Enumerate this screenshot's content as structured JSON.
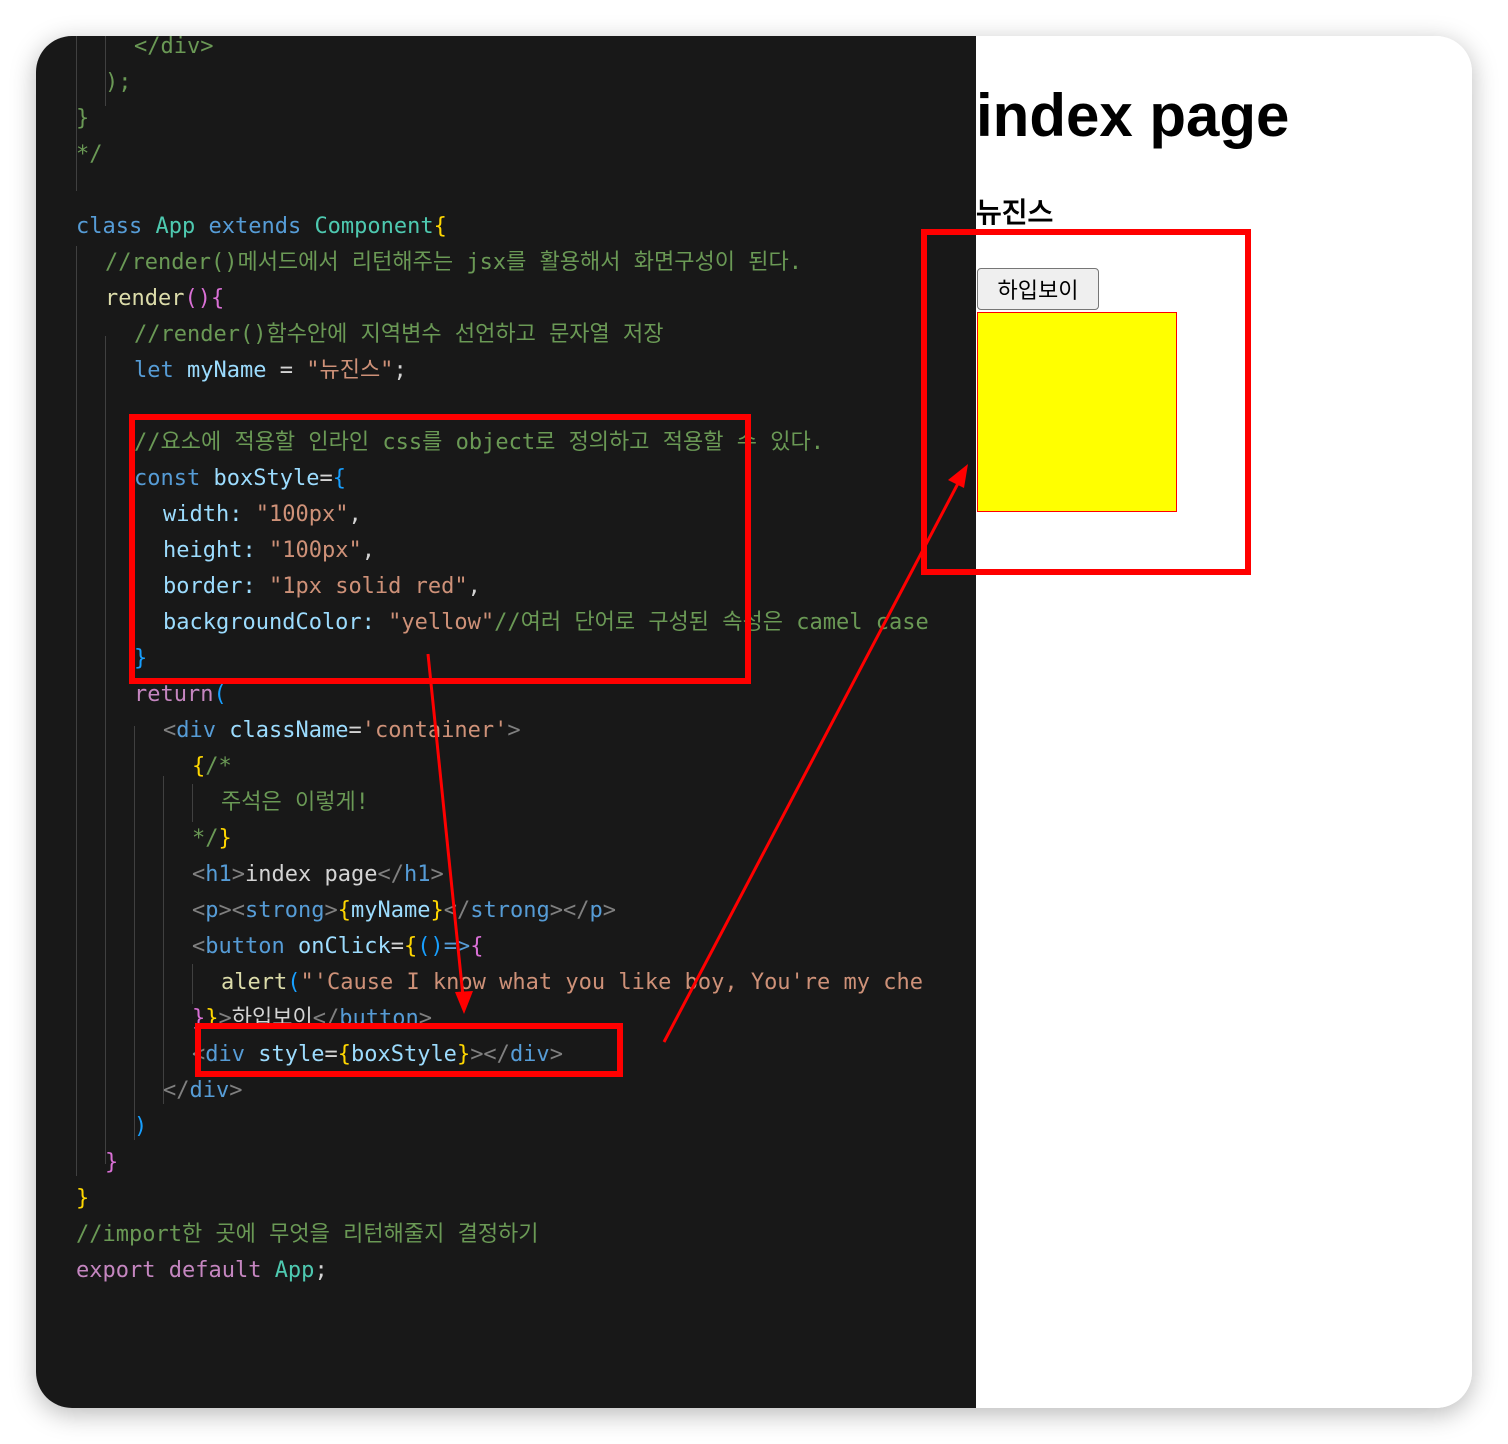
{
  "editor": {
    "lines": [
      {
        "t": "</div>",
        "c": "tok-cm",
        "x": 2
      },
      {
        "t": ");",
        "c": "tok-cm",
        "x": 1
      },
      {
        "t": "}",
        "c": "tok-cm",
        "x": 0
      },
      {
        "t": "*/",
        "c": "tok-cm",
        "x": 0
      },
      {
        "t": "",
        "c": "",
        "x": 0
      },
      {
        "segs": [
          {
            "t": "class ",
            "c": "tok-kw"
          },
          {
            "t": "App ",
            "c": "tok-cls"
          },
          {
            "t": "extends ",
            "c": "tok-kw"
          },
          {
            "t": "Component",
            "c": "tok-cls"
          },
          {
            "t": "{",
            "c": "tok-b1"
          }
        ],
        "x": 0
      },
      {
        "t": "//render()메서드에서 리턴해주는 jsx를 활용해서 화면구성이 된다.",
        "c": "tok-cm",
        "x": 1
      },
      {
        "segs": [
          {
            "t": "render",
            "c": "tok-fn"
          },
          {
            "t": "(){",
            "c": "tok-b2"
          }
        ],
        "x": 1
      },
      {
        "t": "//render()함수안에 지역변수 선언하고 문자열 저장",
        "c": "tok-cm",
        "x": 2
      },
      {
        "segs": [
          {
            "t": "let ",
            "c": "tok-kw"
          },
          {
            "t": "myName",
            "c": "tok-var"
          },
          {
            "t": " = ",
            "c": ""
          },
          {
            "t": "\"뉴진스\"",
            "c": "tok-str"
          },
          {
            "t": ";",
            "c": ""
          }
        ],
        "x": 2
      },
      {
        "t": "",
        "c": "",
        "x": 0
      },
      {
        "t": "//요소에 적용할 인라인 css를 object로 정의하고 적용할 수 있다.",
        "c": "tok-cm",
        "x": 2
      },
      {
        "segs": [
          {
            "t": "const ",
            "c": "tok-kw"
          },
          {
            "t": "boxStyle",
            "c": "tok-var"
          },
          {
            "t": "=",
            "c": ""
          },
          {
            "t": "{",
            "c": "tok-b3"
          }
        ],
        "x": 2
      },
      {
        "segs": [
          {
            "t": "width: ",
            "c": "tok-var"
          },
          {
            "t": "\"100px\"",
            "c": "tok-str"
          },
          {
            "t": ",",
            "c": ""
          }
        ],
        "x": 3
      },
      {
        "segs": [
          {
            "t": "height: ",
            "c": "tok-var"
          },
          {
            "t": "\"100px\"",
            "c": "tok-str"
          },
          {
            "t": ",",
            "c": ""
          }
        ],
        "x": 3
      },
      {
        "segs": [
          {
            "t": "border: ",
            "c": "tok-var"
          },
          {
            "t": "\"1px solid red\"",
            "c": "tok-str"
          },
          {
            "t": ",",
            "c": ""
          }
        ],
        "x": 3
      },
      {
        "segs": [
          {
            "t": "backgroundColor: ",
            "c": "tok-var"
          },
          {
            "t": "\"yellow\"",
            "c": "tok-str"
          },
          {
            "t": "//여러 단어로 구성된 속성은 camel case",
            "c": "tok-cm"
          }
        ],
        "x": 3
      },
      {
        "t": "}",
        "c": "tok-b3",
        "x": 2
      },
      {
        "segs": [
          {
            "t": "return",
            "c": "tok-pink"
          },
          {
            "t": "(",
            "c": "tok-b3"
          }
        ],
        "x": 2
      },
      {
        "segs": [
          {
            "t": "<",
            "c": "tok-punc"
          },
          {
            "t": "div ",
            "c": "tok-tag"
          },
          {
            "t": "className",
            "c": "tok-var"
          },
          {
            "t": "=",
            "c": ""
          },
          {
            "t": "'container'",
            "c": "tok-str"
          },
          {
            "t": ">",
            "c": "tok-punc"
          }
        ],
        "x": 3
      },
      {
        "segs": [
          {
            "t": "{",
            "c": "tok-b1"
          },
          {
            "t": "/*",
            "c": "tok-cm"
          }
        ],
        "x": 4
      },
      {
        "t": "주석은 이렇게!",
        "c": "tok-cm",
        "x": 5
      },
      {
        "segs": [
          {
            "t": "*/",
            "c": "tok-cm"
          },
          {
            "t": "}",
            "c": "tok-b1"
          }
        ],
        "x": 4
      },
      {
        "segs": [
          {
            "t": "<",
            "c": "tok-punc"
          },
          {
            "t": "h1",
            "c": "tok-tag"
          },
          {
            "t": ">",
            "c": "tok-punc"
          },
          {
            "t": "index page",
            "c": ""
          },
          {
            "t": "</",
            "c": "tok-punc"
          },
          {
            "t": "h1",
            "c": "tok-tag"
          },
          {
            "t": ">",
            "c": "tok-punc"
          }
        ],
        "x": 4
      },
      {
        "segs": [
          {
            "t": "<",
            "c": "tok-punc"
          },
          {
            "t": "p",
            "c": "tok-tag"
          },
          {
            "t": "><",
            "c": "tok-punc"
          },
          {
            "t": "strong",
            "c": "tok-tag"
          },
          {
            "t": ">",
            "c": "tok-punc"
          },
          {
            "t": "{",
            "c": "tok-b1"
          },
          {
            "t": "myName",
            "c": "tok-var"
          },
          {
            "t": "}",
            "c": "tok-b1"
          },
          {
            "t": "</",
            "c": "tok-punc"
          },
          {
            "t": "strong",
            "c": "tok-tag"
          },
          {
            "t": "></",
            "c": "tok-punc"
          },
          {
            "t": "p",
            "c": "tok-tag"
          },
          {
            "t": ">",
            "c": "tok-punc"
          }
        ],
        "x": 4
      },
      {
        "segs": [
          {
            "t": "<",
            "c": "tok-punc"
          },
          {
            "t": "button ",
            "c": "tok-tag"
          },
          {
            "t": "onClick",
            "c": "tok-var"
          },
          {
            "t": "=",
            "c": ""
          },
          {
            "t": "{",
            "c": "tok-b1"
          },
          {
            "t": "()",
            "c": "tok-b3"
          },
          {
            "t": "=>",
            "c": "tok-kw"
          },
          {
            "t": "{",
            "c": "tok-b2"
          }
        ],
        "x": 4
      },
      {
        "segs": [
          {
            "t": "alert",
            "c": "tok-fn"
          },
          {
            "t": "(",
            "c": "tok-b3"
          },
          {
            "t": "\"'Cause I know what you like boy, You're my che",
            "c": "tok-str"
          }
        ],
        "x": 5
      },
      {
        "segs": [
          {
            "t": "}",
            "c": "tok-b2"
          },
          {
            "t": "}",
            "c": "tok-b1"
          },
          {
            "t": ">",
            "c": "tok-punc"
          },
          {
            "t": "하입보이",
            "c": ""
          },
          {
            "t": "</",
            "c": "tok-punc"
          },
          {
            "t": "button",
            "c": "tok-tag"
          },
          {
            "t": ">",
            "c": "tok-punc"
          }
        ],
        "x": 4
      },
      {
        "segs": [
          {
            "t": "<",
            "c": "tok-punc"
          },
          {
            "t": "div ",
            "c": "tok-tag"
          },
          {
            "t": "style",
            "c": "tok-var"
          },
          {
            "t": "=",
            "c": ""
          },
          {
            "t": "{",
            "c": "tok-b1"
          },
          {
            "t": "boxStyle",
            "c": "tok-var"
          },
          {
            "t": "}",
            "c": "tok-b1"
          },
          {
            "t": "></",
            "c": "tok-punc"
          },
          {
            "t": "div",
            "c": "tok-tag"
          },
          {
            "t": ">",
            "c": "tok-punc"
          }
        ],
        "x": 4
      },
      {
        "segs": [
          {
            "t": "</",
            "c": "tok-punc"
          },
          {
            "t": "div",
            "c": "tok-tag"
          },
          {
            "t": ">",
            "c": "tok-punc"
          }
        ],
        "x": 3
      },
      {
        "t": ")",
        "c": "tok-b3",
        "x": 2
      },
      {
        "t": "}",
        "c": "tok-b2",
        "x": 1
      },
      {
        "t": "}",
        "c": "tok-b1",
        "x": 0
      },
      {
        "t": "//import한 곳에 무엇을 리턴해줄지 결정하기",
        "c": "tok-cm",
        "x": 0
      },
      {
        "segs": [
          {
            "t": "export ",
            "c": "tok-pink"
          },
          {
            "t": "default ",
            "c": "tok-pink"
          },
          {
            "t": "App",
            "c": "tok-cls"
          },
          {
            "t": ";",
            "c": ""
          }
        ],
        "x": 0
      }
    ]
  },
  "preview": {
    "heading": "index page",
    "name": "뉴진스",
    "button_label": "하입보이",
    "box_color": "#ffff00",
    "box_border_color": "#ff0000"
  },
  "annotation_color": "#ff0000"
}
